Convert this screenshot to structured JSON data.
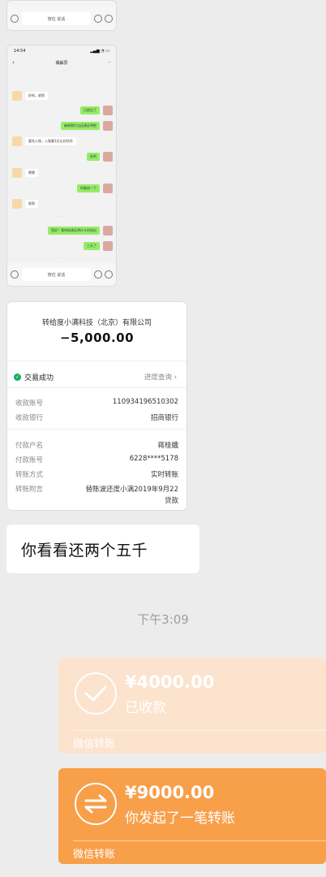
{
  "shot_top": {
    "input_text": "按住 说话"
  },
  "shot_chat": {
    "status_time": "14:54",
    "title": "偶解员",
    "messages": [
      {
        "side": "in",
        "text": "好的，收到"
      },
      {
        "side": "out",
        "text": "已经还了"
      },
      {
        "side": "out",
        "text": "麻烦帮忙出还清证明吧"
      },
      {
        "side": "in",
        "text": "要先入账，入账要3天左右时间"
      },
      {
        "side": "out",
        "text": "好的"
      },
      {
        "side": "in",
        "text": "嗯嗯"
      },
      {
        "side": "out",
        "text": "你跟进一下"
      },
      {
        "side": "in",
        "text": "收到"
      },
      {
        "side": "out",
        "text": "您好！我的结清证明什么时间出"
      },
      {
        "side": "out",
        "text": "三天了"
      }
    ],
    "input_text": "按住 说话"
  },
  "receipt": {
    "payee": "转给度小满科技（北京）有限公司",
    "amount": "−5,000.00",
    "status": "交易成功",
    "progress_link": "进度查询",
    "rows": [
      {
        "label": "收款账号",
        "value": "110934196510302"
      },
      {
        "label": "收款银行",
        "value": "招商银行"
      },
      {
        "label": "付款户名",
        "value": "蒋桂娥"
      },
      {
        "label": "付款账号",
        "value": "6228****5178"
      },
      {
        "label": "转账方式",
        "value": "实时转账"
      },
      {
        "label": "转账附言",
        "value": "替陈波还度小满2019年9月22"
      },
      {
        "label": "",
        "value": "贷款"
      }
    ]
  },
  "message_text": "你看看还两个五千",
  "timestamp": "下午3:09",
  "transfers": [
    {
      "amount": "¥4000.00",
      "status": "已收款",
      "footer": "微信转账",
      "icon": "check-icon"
    },
    {
      "amount": "¥9000.00",
      "status": "你发起了一笔转账",
      "footer": "微信转账",
      "icon": "transfer-arrows-icon"
    }
  ],
  "colors": {
    "received_card": "#fbe3cd",
    "sent_card": "#f89f4a",
    "success_green": "#1aad5f",
    "wechat_out_bubble": "#95ec69"
  }
}
